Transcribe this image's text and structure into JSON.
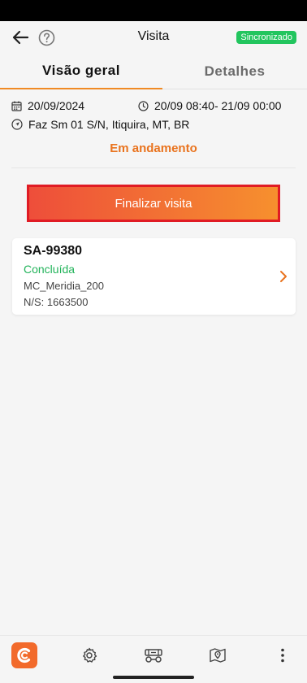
{
  "header": {
    "title": "Visita",
    "sync_badge": "Sincronizado",
    "icons": {
      "back": "arrow-left-icon",
      "help": "help-circle-icon"
    }
  },
  "tabs": [
    {
      "label": "Visão geral",
      "active": true
    },
    {
      "label": "Detalhes",
      "active": false
    }
  ],
  "visit": {
    "date": "20/09/2024",
    "time_range": "20/09 08:40- 21/09 00:00",
    "address": "Faz Sm 01 S/N, Itiquira, MT, BR",
    "status": "Em andamento"
  },
  "actions": {
    "finish_label": "Finalizar visita"
  },
  "items": [
    {
      "code": "SA-99380",
      "status": "Concluída",
      "model": "MC_Meridia_200",
      "serial": "N/S: 1663500"
    }
  ],
  "bottom_nav": {
    "icons": [
      "app-logo-icon",
      "settings-icon",
      "equipment-icon",
      "map-pin-icon",
      "more-vertical-icon"
    ]
  },
  "colors": {
    "accent": "#f08a24",
    "status_in_progress": "#e9731e",
    "status_done": "#22b35a",
    "sync_badge": "#22c55e",
    "highlight_border": "#e01b24"
  }
}
